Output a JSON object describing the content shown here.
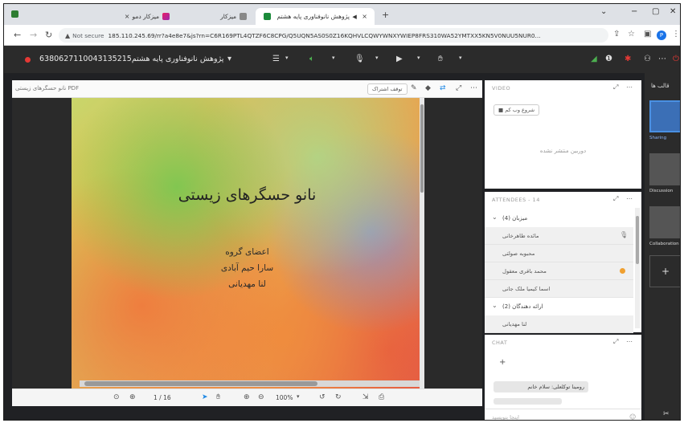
{
  "browser": {
    "tabs": [
      {
        "label": "میزکار دمو"
      },
      {
        "label": "میزکار"
      },
      {
        "label": "پژوهش نانوفناوری پایه هشتم"
      }
    ],
    "url_warning": "Not secure",
    "url": "185.110.245.69/rr?a4e8e7&js?rn=C6R169PTL4QTZF6C8CPG/Q5UQN5AS0S0Z16KQHVLCQWYWNXYWIEP8FRS310WA52YMTXX5KN5V0NUU5NUR0...",
    "avatar_letter": "P"
  },
  "app": {
    "room_title": "پژوهش نانوفناوری پایه هشتم6380627110043135215"
  },
  "content": {
    "doc_title": "نانو حسگرهای زیستی",
    "doc_type": "PDF",
    "stop_share_label": "توقف اشتراک",
    "slide_title": "نانو حسگرهای زیستی",
    "slide_lines": [
      "اعضای گروه",
      "سارا حیم آبادی",
      "لنا مهدیانی"
    ],
    "page_current": "1",
    "page_total": "16",
    "zoom": "100%"
  },
  "video": {
    "header": "VIDEO",
    "webcam_button": "شروع وب کم",
    "no_cam_text": "دوربین منتشر نشده"
  },
  "attendees": {
    "header": "ATTENDEES - 14",
    "groups": [
      {
        "label": "میزبان (4)",
        "rows": [
          "مائده طاهرخانی",
          "محبوبه صولتی",
          "محمد باقری معقول",
          "اسما کیمیا ملک جانی"
        ]
      },
      {
        "label": "ارائه دهندگان (2)",
        "rows": [
          "لنا مهدیانی"
        ]
      }
    ]
  },
  "chat": {
    "header": "CHAT",
    "message": "رومینا توکلعلی: سلام خانم",
    "input_placeholder": "اینجا بنویسید"
  },
  "layouts": {
    "title": "قالب ها",
    "items": [
      "Sharing",
      "Discussion",
      "Collaboration"
    ]
  }
}
